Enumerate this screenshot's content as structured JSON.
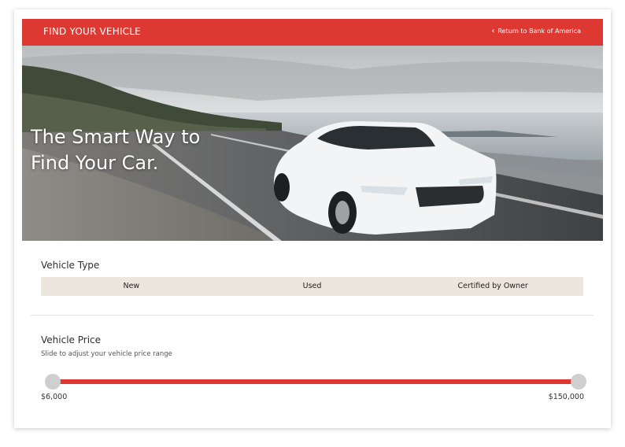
{
  "header": {
    "title": "FIND YOUR VEHICLE",
    "return_link": "Return to Bank of America",
    "accent_color": "#dd3831"
  },
  "hero": {
    "headline_line1": "The Smart Way to",
    "headline_line2": "Find Your Car."
  },
  "vehicle_type": {
    "title": "Vehicle Type",
    "options": [
      "New",
      "Used",
      "Certified by Owner"
    ]
  },
  "vehicle_price": {
    "title": "Vehicle Price",
    "subtitle": "Slide to adjust your vehicle price range",
    "min_label": "$6,000",
    "max_label": "$150,000",
    "range_selected": [
      6000,
      150000
    ]
  },
  "icons": [
    "chevron-left-icon"
  ]
}
